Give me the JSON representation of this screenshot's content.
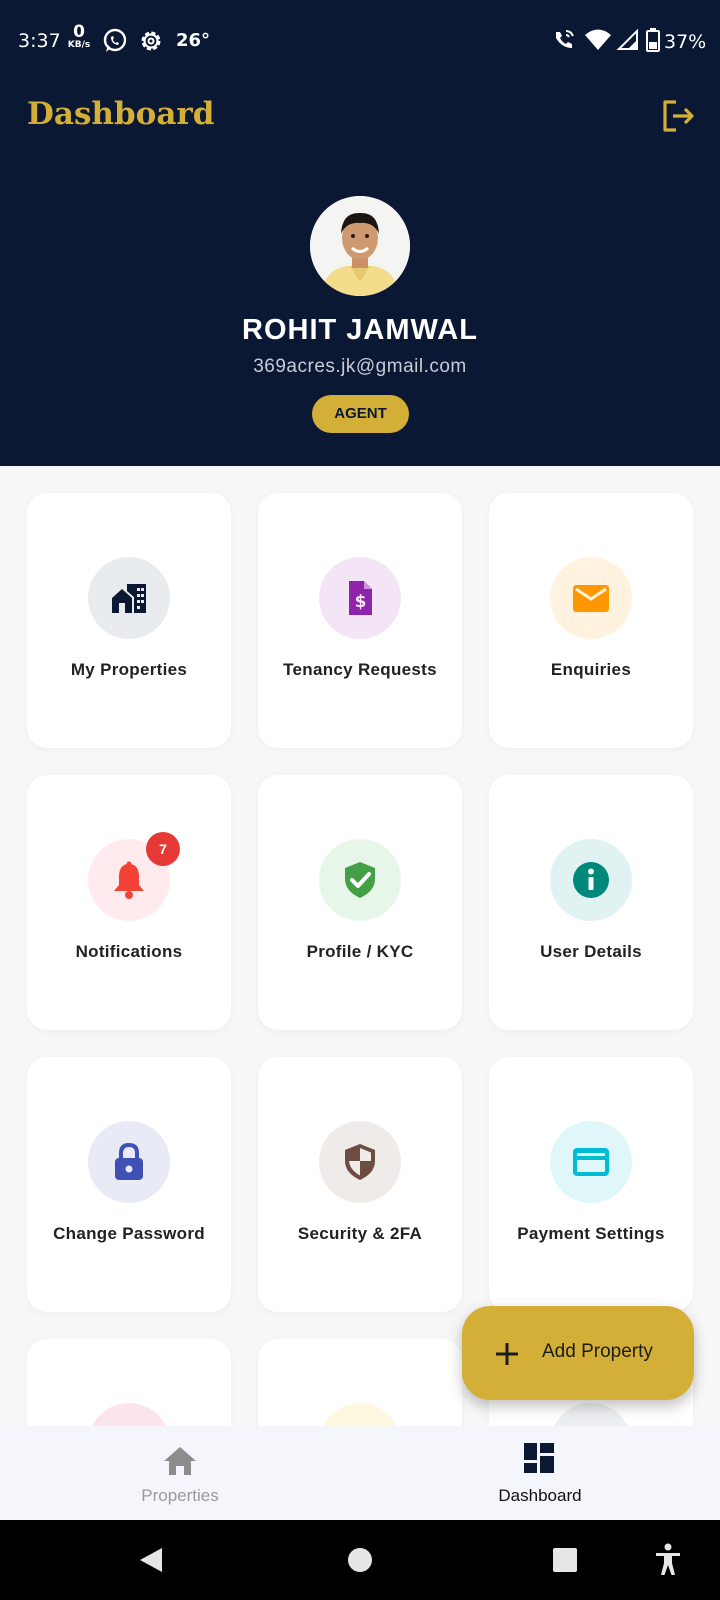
{
  "status_bar": {
    "time": "3:37",
    "net_speed_value": "0",
    "net_speed_unit": "KB/s",
    "temperature": "26°",
    "battery": "37%",
    "icons": [
      "whatsapp-icon",
      "settings-gear-icon",
      "wifi-call-icon",
      "wifi-icon",
      "signal-icon",
      "battery-icon"
    ]
  },
  "header": {
    "title": "Dashboard",
    "logout_icon": "logout-icon"
  },
  "profile": {
    "name": "ROHIT JAMWAL",
    "email": "369acres.jk@gmail.com",
    "role": "AGENT"
  },
  "cards": [
    {
      "label": "My Properties",
      "icon": "buildings-icon",
      "color": "#0b1833",
      "bg": "#e9ecef"
    },
    {
      "label": "Tenancy Requests",
      "icon": "invoice-dollar-icon",
      "color": "#8e24aa",
      "bg": "#f3e5f5"
    },
    {
      "label": "Enquiries",
      "icon": "mail-icon",
      "color": "#ff9800",
      "bg": "#fff3e0"
    },
    {
      "label": "Notifications",
      "icon": "bell-icon",
      "color": "#f44336",
      "bg": "#ffebee",
      "badge": "7"
    },
    {
      "label": "Profile / KYC",
      "icon": "verified-shield-icon",
      "color": "#43a047",
      "bg": "#e8f5e9"
    },
    {
      "label": "User Details",
      "icon": "info-icon",
      "color": "#00897b",
      "bg": "#e0f2f1"
    },
    {
      "label": "Change Password",
      "icon": "lock-icon",
      "color": "#3f51b5",
      "bg": "#e8eaf6"
    },
    {
      "label": "Security & 2FA",
      "icon": "security-shield-icon",
      "color": "#6d4c41",
      "bg": "#efebe9"
    },
    {
      "label": "Payment Settings",
      "icon": "credit-card-icon",
      "color": "#00bcd4",
      "bg": "#e0f7fa"
    }
  ],
  "fab": {
    "label": "Add Property",
    "icon": "plus-icon"
  },
  "bottom_nav": {
    "items": [
      {
        "label": "Properties",
        "icon": "home-icon",
        "active": false
      },
      {
        "label": "Dashboard",
        "icon": "dashboard-icon",
        "active": true
      }
    ]
  },
  "system_nav": [
    "back-icon",
    "home-circle-icon",
    "recents-icon",
    "accessibility-icon"
  ],
  "colors": {
    "header_bg": "#0b1833",
    "accent": "#d4af37",
    "badge": "#e53935"
  }
}
